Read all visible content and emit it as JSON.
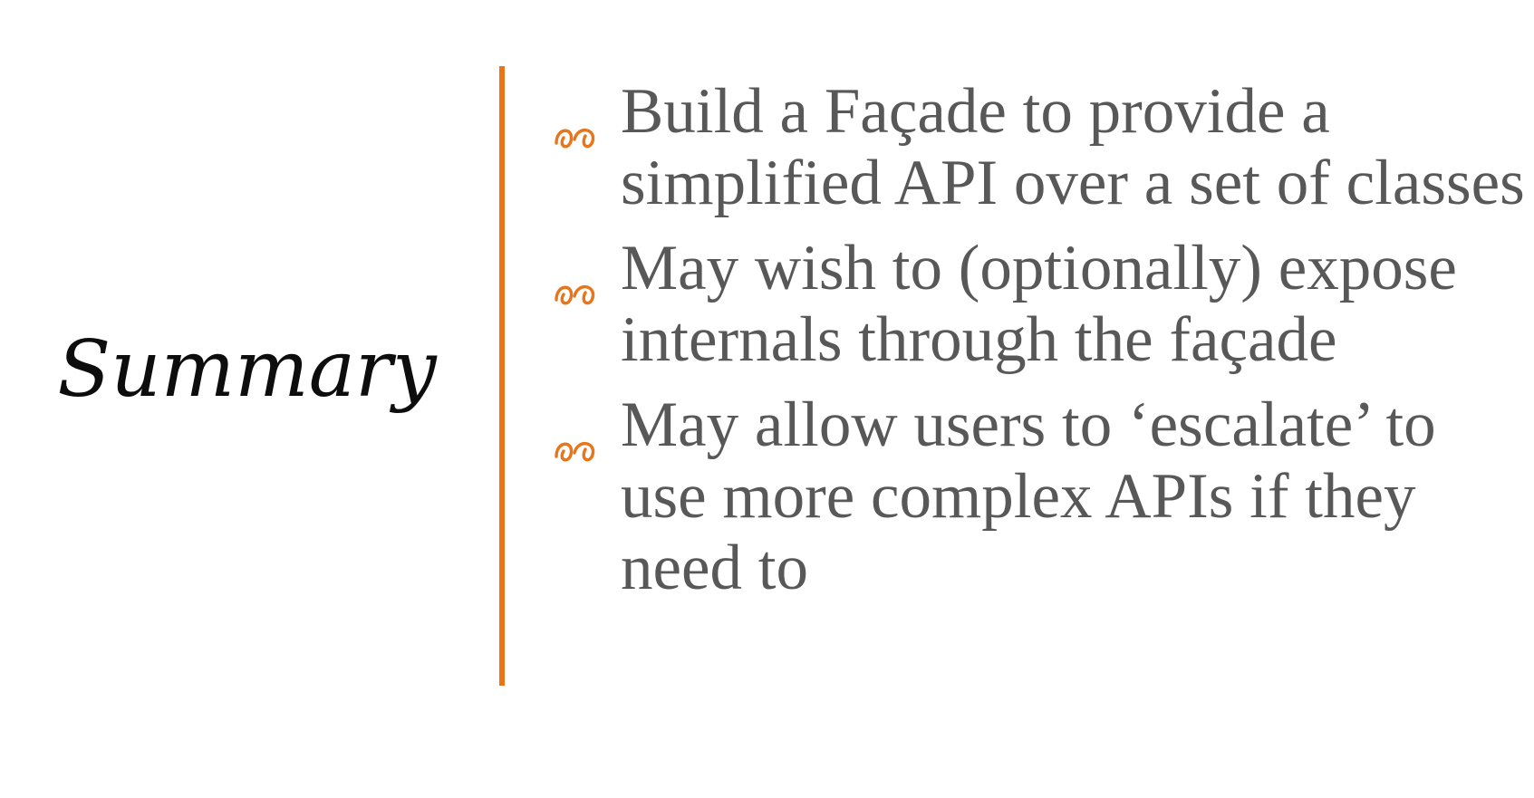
{
  "slide": {
    "title": "Summary",
    "accent_color": "#e8751a",
    "bullet_icon": "swirl-ornament-icon",
    "bullets": [
      {
        "text": "Build a Façade to provide a simplified API over a set of classes"
      },
      {
        "text": "May wish to (optionally) expose internals through the façade"
      },
      {
        "text": "May allow users to ‘escalate’ to use more complex APIs if they need to"
      }
    ]
  }
}
